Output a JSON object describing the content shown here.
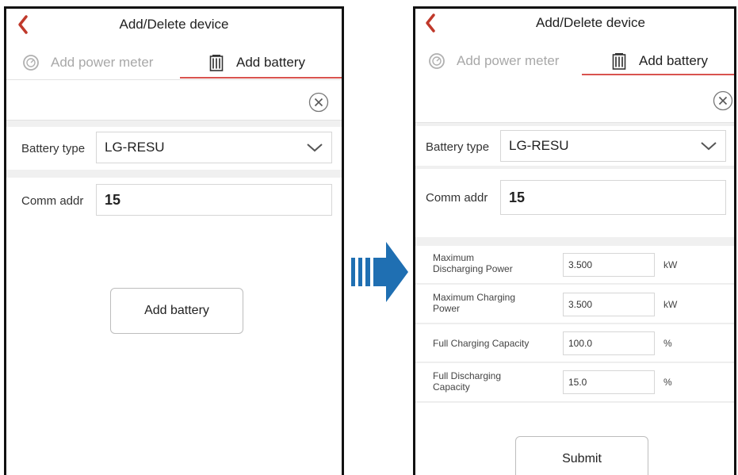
{
  "left_screen": {
    "title": "Add/Delete device",
    "tabs": [
      {
        "label": "Add power meter",
        "icon": "power-meter-icon",
        "active": false
      },
      {
        "label": "Add battery",
        "icon": "battery-icon",
        "active": true
      }
    ],
    "battery_type_label": "Battery type",
    "battery_type_value": "LG-RESU",
    "comm_addr_label": "Comm addr",
    "comm_addr_value": "15",
    "add_button": "Add battery"
  },
  "right_screen": {
    "title": "Add/Delete device",
    "tabs": [
      {
        "label": "Add power meter",
        "icon": "power-meter-icon",
        "active": false
      },
      {
        "label": "Add battery",
        "icon": "battery-icon",
        "active": true
      }
    ],
    "battery_type_label": "Battery type",
    "battery_type_value": "LG-RESU",
    "comm_addr_label": "Comm addr",
    "comm_addr_value": "15",
    "params": [
      {
        "label_line1": "Maximum",
        "label_line2": "Discharging Power",
        "value": "3.500",
        "unit": "kW"
      },
      {
        "label_line1": "Maximum Charging",
        "label_line2": "Power",
        "value": "3.500",
        "unit": "kW"
      },
      {
        "label_line1": "Full Charging Capacity",
        "label_line2": "",
        "value": "100.0",
        "unit": "%"
      },
      {
        "label_line1": "Full Discharging",
        "label_line2": "Capacity",
        "value": "15.0",
        "unit": "%"
      }
    ],
    "submit_button": "Submit"
  },
  "colors": {
    "accent": "#d9534f",
    "back_arrow": "#c0392b",
    "arrow_blue": "#1f6fb2",
    "content_bg": "#f0f0f0"
  }
}
